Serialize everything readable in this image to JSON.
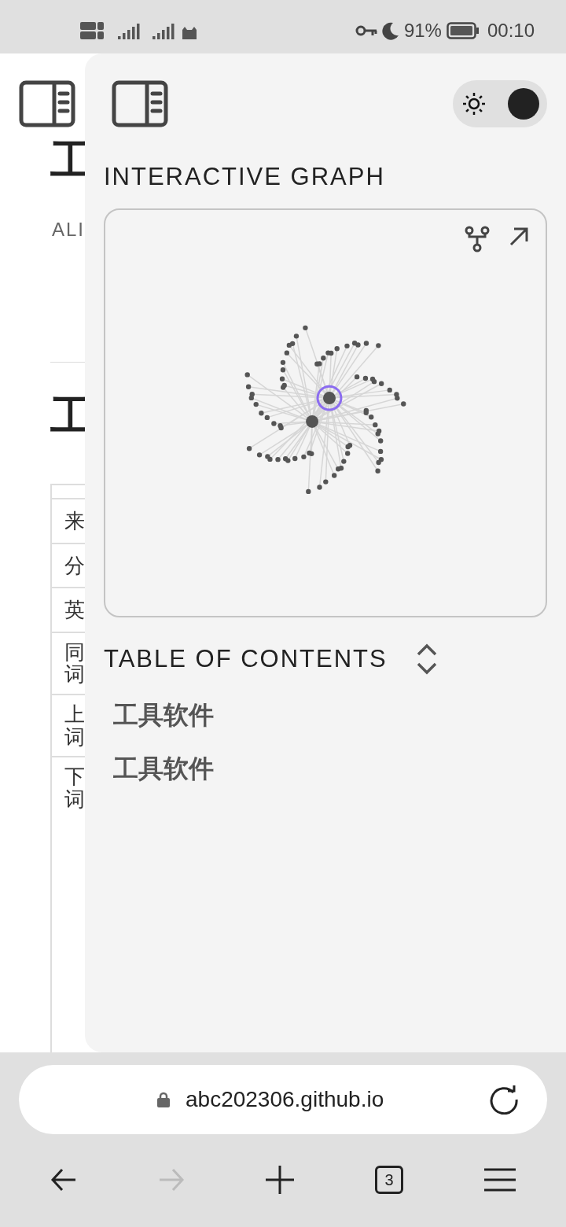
{
  "status_bar": {
    "battery": "91%",
    "time": "00:10"
  },
  "background_page": {
    "headings": [
      "工",
      "工"
    ],
    "subtitle": "ALI",
    "table_cells": [
      "来",
      "分",
      "英",
      "同词",
      "上词",
      "下词"
    ]
  },
  "drawer": {
    "theme_toggle": {
      "on": true
    },
    "graph_title": "INTERACTIVE GRAPH",
    "toc_title": "TABLE OF CONTENTS",
    "toc_items": [
      "工具软件",
      "工具软件"
    ]
  },
  "browser": {
    "url": "abc202306.github.io",
    "tab_count": "3",
    "forward_disabled": true
  }
}
